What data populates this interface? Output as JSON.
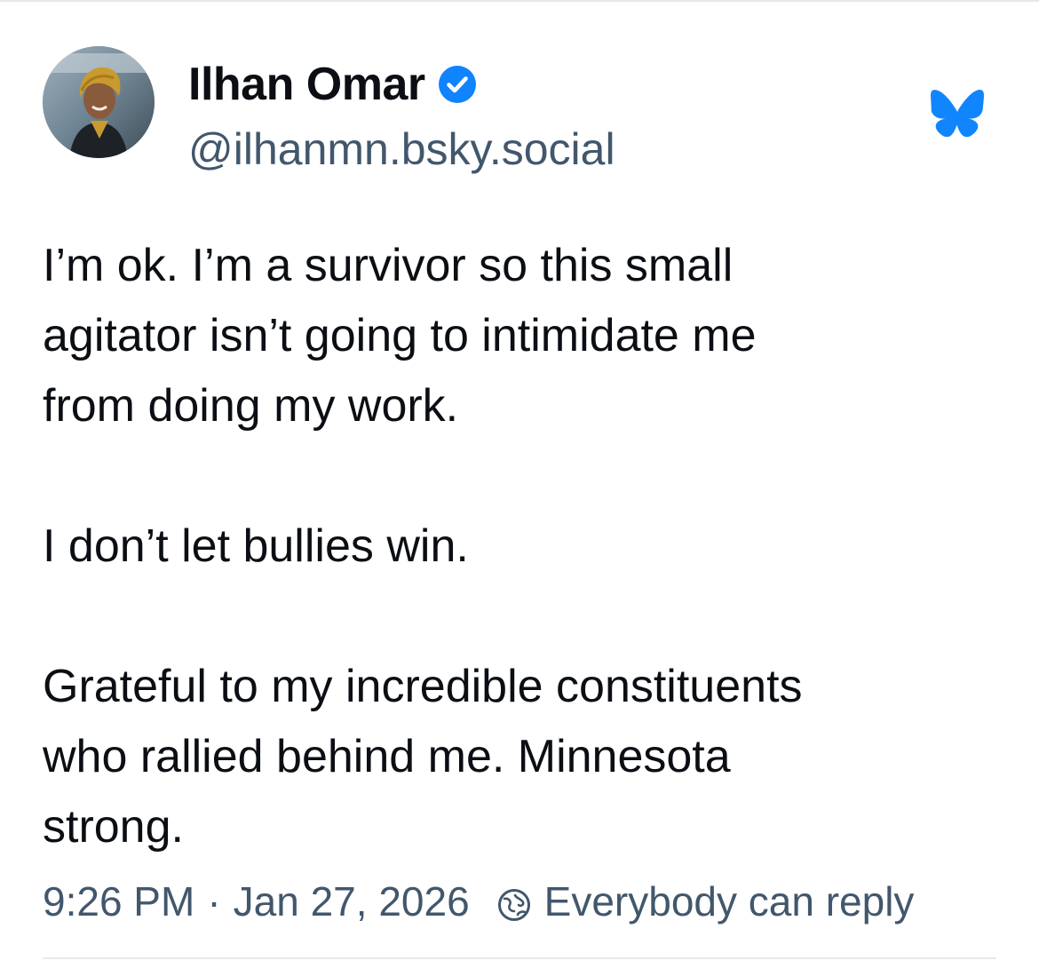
{
  "post": {
    "author": {
      "display_name": "Ilhan Omar",
      "handle": "@ilhanmn.bsky.social",
      "verified": true,
      "avatar": "avatar-photo"
    },
    "text_lines": {
      "p1": [
        "I’m ok. I’m a survivor so this small",
        "agitator isn’t going to intimidate me",
        "from doing my work."
      ],
      "p2": [
        "I don’t let bullies win."
      ],
      "p3": [
        "Grateful to my incredible constituents",
        "who rallied behind me. Minnesota",
        "strong."
      ]
    },
    "meta": {
      "time": "9:26 PM",
      "separator": "·",
      "date": "Jan 27, 2026",
      "reply_setting": "Everybody can reply"
    }
  },
  "icons": {
    "verified": "verified-badge-icon",
    "app": "bluesky-butterfly-icon",
    "reply": "reply-settings-icon"
  },
  "colors": {
    "verified_blue": "#1083fe",
    "butterfly_blue": "#1185fe",
    "text": "#0b0f14",
    "muted": "#42576c"
  }
}
